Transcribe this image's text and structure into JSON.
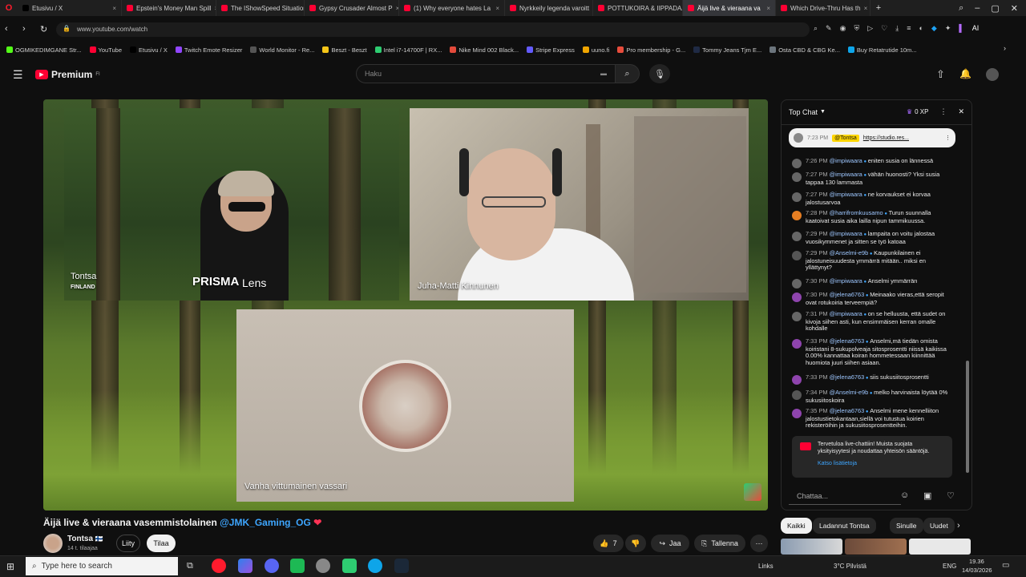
{
  "browser": {
    "tabs": [
      {
        "label": "Etusivu / X",
        "color": "#000000",
        "active": false
      },
      {
        "label": "Epstein's Money Man Spill",
        "color": "#ff0033",
        "active": false
      },
      {
        "label": "The IShowSpeed Situation",
        "color": "#ff0033",
        "active": false
      },
      {
        "label": "Gypsy Crusader Almost P",
        "color": "#ff0033",
        "active": false
      },
      {
        "label": "(1) Why everyone hates La",
        "color": "#ff0033",
        "active": false
      },
      {
        "label": "Nyrkkeily legenda varoitt",
        "color": "#ff0033",
        "active": false
      },
      {
        "label": "POTTUKOIRA & IIPPADAA",
        "color": "#ff0033",
        "active": false
      },
      {
        "label": "Äijä live & vieraana va",
        "color": "#ff0033",
        "active": true
      },
      {
        "label": "Which Drive-Thru Has th",
        "color": "#ff0033",
        "active": false
      }
    ],
    "url": "www.youtube.com/watch",
    "ai_label": "AI",
    "bookmarks": [
      {
        "label": "OGMIKEDIMGANE Str...",
        "color": "#53fc18"
      },
      {
        "label": "YouTube",
        "color": "#ff0033"
      },
      {
        "label": "Etusivu / X",
        "color": "#000000"
      },
      {
        "label": "Twitch Emote Resizer",
        "color": "#9146ff"
      },
      {
        "label": "World Monitor - Re...",
        "color": "#555555"
      },
      {
        "label": "Beszt - Beszt",
        "color": "#f5c518"
      },
      {
        "label": "Intel i7-14700F | RX...",
        "color": "#2ecc71"
      },
      {
        "label": "Nike Mind 002 Black...",
        "color": "#e34a3b"
      },
      {
        "label": "Stripe Express",
        "color": "#635bff"
      },
      {
        "label": "uuno.fi",
        "color": "#f0a500"
      },
      {
        "label": "Pro membership - G...",
        "color": "#e74c3c"
      },
      {
        "label": "Tommy Jeans Tjm E...",
        "color": "#1f2a44"
      },
      {
        "label": "Osta CBD & CBG Ke...",
        "color": "#6c757d"
      },
      {
        "label": "Buy Retatrutide 10m...",
        "color": "#0ea5e9"
      }
    ]
  },
  "youtube": {
    "logo_text": "Premium",
    "logo_sup": "FI",
    "search_placeholder": "Haku"
  },
  "video": {
    "cam1_name": "Tontsa",
    "cam1_sub": "FINLAND",
    "cam1_shirt": "PRISMA",
    "cam1_watermark": "Lens",
    "cam2_name": "Juha-Matti Kinnunen",
    "cam3_name": "Vanha vittumainen vassari",
    "title_main": "Äijä live & vieraana vasemmistolainen ",
    "title_mention": "@JMK_Gaming_OG",
    "title_heart": "❤"
  },
  "channel": {
    "name": "Tontsa",
    "flag": "🇫🇮",
    "subscribers": "14 t. tilaajaa",
    "join": "Liity",
    "subscribe": "Tilaa"
  },
  "actions": {
    "likes": "7",
    "share": "Jaa",
    "save": "Tallenna"
  },
  "chat": {
    "mode": "Top Chat",
    "xp": "0 XP",
    "pinned_user": "@Tontsa",
    "pinned_text": "https://studio.res...",
    "pinned_time": "7:23 PM",
    "messages": [
      {
        "time": "7:26 PM",
        "user": "@impiwaara",
        "text": "eniten susia on lännessä",
        "color": "#666666"
      },
      {
        "time": "7:27 PM",
        "user": "@impiwaara",
        "text": "vähän huonosti? Yksi susia tappaa 130 lammasta",
        "color": "#666666"
      },
      {
        "time": "7:27 PM",
        "user": "@impiwaara",
        "text": "ne korvaukset ei korvaa jalostusarvoa",
        "color": "#666666"
      },
      {
        "time": "7:28 PM",
        "user": "@harrifromkuusamo",
        "text": "Turun suunnalla kaatoivat susia aika lailla nipun tammikuussa.",
        "color": "#e67e22"
      },
      {
        "time": "7:29 PM",
        "user": "@impiwaara",
        "text": "lampaita on voitu jalostaa vuosikymmenet ja sitten se työ katoaa",
        "color": "#666666"
      },
      {
        "time": "7:29 PM",
        "user": "@Anselmi-e9b",
        "text": "Kaupunkilainen ei jalostuneisuudesta ymmärrä mitään.. miksi en yllättynyt?",
        "color": "#555555"
      },
      {
        "time": "7:30 PM",
        "user": "@impiwaara",
        "text": "Anselmi ymmärrän",
        "color": "#666666"
      },
      {
        "time": "7:30 PM",
        "user": "@jelena6763",
        "text": "Meinaako vieras,että seropit ovat rotukoiria terveempiä?",
        "color": "#8e44ad"
      },
      {
        "time": "7:31 PM",
        "user": "@impiwaara",
        "text": "on se helluusta, että sudet on kivoja siihen asti, kun ensimmäisen kerran omalle kohdalle",
        "color": "#666666"
      },
      {
        "time": "7:33 PM",
        "user": "@jelena6763",
        "text": "Anselmi,mä tiedän omista koiristani 8-sukupolveaja sitosprosentti niissä kaikissa 0.00% kannattaa koiran hommetessaan kiinnittää huomiota juuri siihen asiaan.",
        "color": "#8e44ad"
      },
      {
        "time": "7:33 PM",
        "user": "@jelena6763",
        "text": "siis sukusiitosprosentti",
        "color": "#8e44ad"
      },
      {
        "time": "7:34 PM",
        "user": "@Anselmi-e9b",
        "text": "melko harvinaista löytää 0% sukusiitoskoira",
        "color": "#555555"
      },
      {
        "time": "7:35 PM",
        "user": "@jelena6763",
        "text": "Anselmi mene kennelliiton jalostustietokantaan,siellä voi tutustua koirien rekisteröihin ja sukusiitosprosentteihin.",
        "color": "#8e44ad"
      }
    ],
    "welcome_text": "Tervetuloa live-chattiin! Muista suojata yksityisyytesi ja noudattaa yhteisön sääntöjä.",
    "welcome_link": "Katso lisätietoja",
    "input_placeholder": "Chattaa..."
  },
  "chips": [
    "Kaikki",
    "Ladannut Tontsa",
    "Sinulle",
    "Uudet"
  ],
  "taskbar": {
    "search_placeholder": "Type here to search",
    "links": "Links",
    "weather": "3°C  Pilvistä",
    "lang": "ENG",
    "time": "19.36",
    "date": "14/03/2026"
  }
}
